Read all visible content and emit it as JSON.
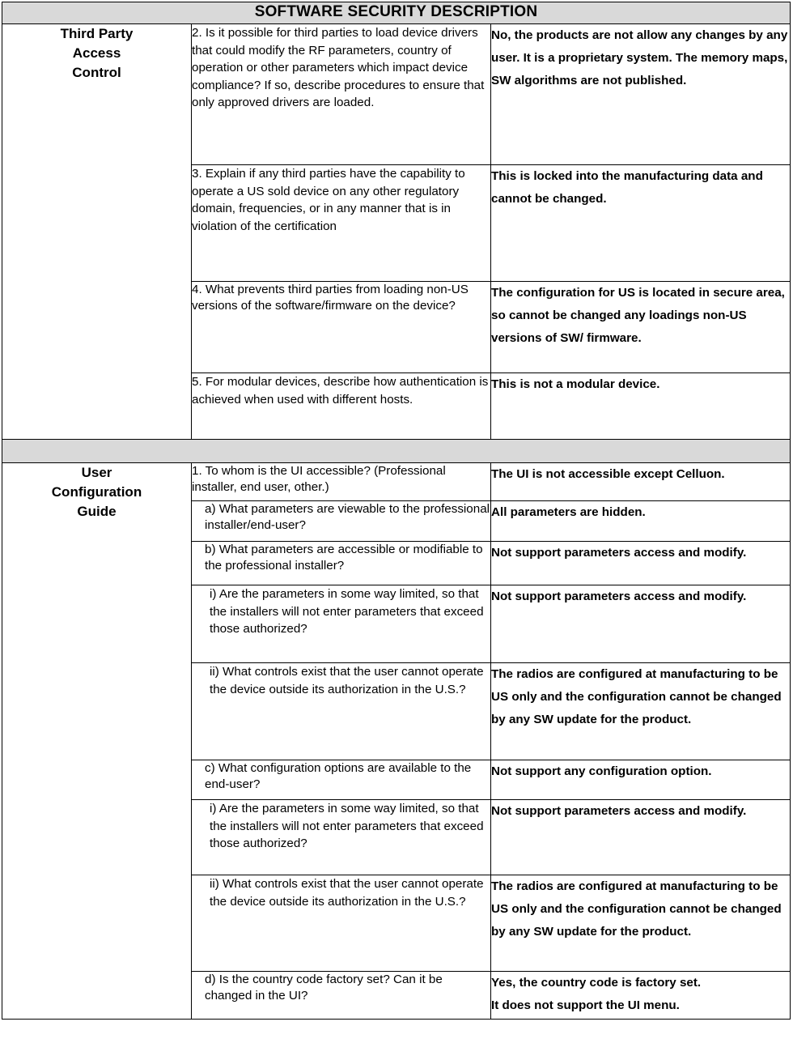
{
  "document": {
    "banner_title": "SOFTWARE SECURITY DESCRIPTION",
    "banner_bg": "#d9d9d9",
    "border_color": "#000000"
  },
  "sections": [
    {
      "label": "Third Party\nAccess\nControl",
      "label_lines": [
        "Third Party",
        "Access",
        "Control"
      ],
      "rows": [
        {
          "question": "2. Is it possible for third parties to load device drivers that could modify the RF parameters, country of operation or other parameters which impact device compliance? If so, describe procedures to ensure that only approved drivers are loaded.",
          "answer": "No, the products are not allow any changes by any user. It is a proprietary system. The memory maps, SW algorithms are not published."
        },
        {
          "question": "3. Explain if any third parties have the capability to operate a US sold device on any other regulatory domain, frequencies, or in any manner that is in violation of the certification",
          "answer": "This is locked into the manufacturing data and cannot be changed."
        },
        {
          "question": "4. What prevents third parties from loading non-US versions of the software/firmware on the device?",
          "answer": "The configuration for US is located in secure area, so cannot be changed any loadings non-US versions of SW/ firmware."
        },
        {
          "question": "5. For modular devices, describe how authentication is achieved when used with different hosts.",
          "answer": "This is not a modular device."
        }
      ]
    },
    {
      "label": "User\nConfiguration\nGuide",
      "label_lines": [
        "User",
        "Configuration",
        "Guide"
      ],
      "rows": [
        {
          "question": "1. To whom is the UI accessible? (Professional installer, end user, other.)",
          "answer": "The UI is not accessible except Celluon."
        },
        {
          "question": "a)  What parameters are viewable to the professional installer/end-user?",
          "answer": "All parameters are hidden."
        },
        {
          "question": "b)  What parameters are accessible or modifiable to the professional installer?",
          "answer": "Not support  parameters access and modify."
        },
        {
          "question": "i) Are the parameters in some way limited, so that the installers will not enter parameters that exceed those authorized?",
          "answer": "Not support  parameters access and modify."
        },
        {
          "question": "ii) What controls exist that the user cannot operate the device outside its authorization in the U.S.?",
          "answer": "The radios are configured at manufacturing to be US only and the configuration cannot be changed by any SW update for the product."
        },
        {
          "question": "c) What configuration options are available to the end-user?",
          "answer": "Not support any configuration option."
        },
        {
          "question": "i) Are the parameters in some way limited, so that the installers will not enter parameters that exceed those authorized?",
          "answer": "Not support  parameters access and modify."
        },
        {
          "question": "ii) What controls exist that the user cannot operate the device outside its authorization in the U.S.?",
          "answer": "The radios are configured at manufacturing to be US only and the configuration cannot be changed by any SW update for the product."
        },
        {
          "question": "d)  Is the country code factory set? Can it be changed in the UI?",
          "answer": "Yes, the country code is factory set.\nIt does not support the UI menu."
        }
      ]
    }
  ],
  "answer_last": {
    "line1": "Yes, the country code is factory set.",
    "line2": "It does not support the UI menu."
  }
}
